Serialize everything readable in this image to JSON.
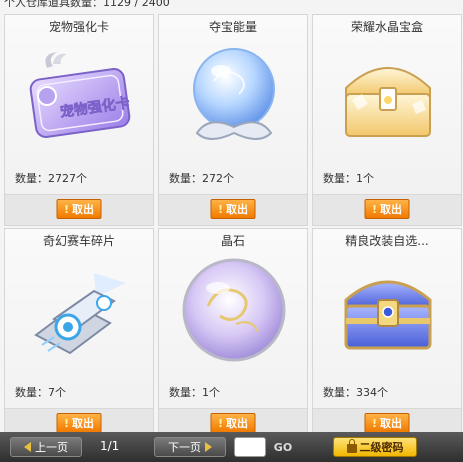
{
  "header": {
    "capacity_text": "个人仓库道具数量：1129 / 2400"
  },
  "items": [
    {
      "name": "宠物强化卡",
      "qty_label": "数量：",
      "qty": "2727个",
      "action": "取出",
      "icon": "pet-enhance-card-icon",
      "card_text": "宠物强化卡"
    },
    {
      "name": "夺宝能量",
      "qty_label": "数量：",
      "qty": "272个",
      "action": "取出",
      "icon": "energy-orb-icon"
    },
    {
      "name": "荣耀水晶宝盒",
      "qty_label": "数量：",
      "qty": "1个",
      "action": "取出",
      "icon": "crystal-chest-icon"
    },
    {
      "name": "奇幻赛车碎片",
      "qty_label": "数量：",
      "qty": "7个",
      "action": "取出",
      "icon": "kart-fragment-icon"
    },
    {
      "name": "晶石",
      "qty_label": "数量：",
      "qty": "1个",
      "action": "取出",
      "icon": "crystal-stone-icon"
    },
    {
      "name": "精良改装自选...",
      "qty_label": "数量：",
      "qty": "334个",
      "action": "取出",
      "icon": "mod-chest-icon"
    }
  ],
  "pagination": {
    "prev_label": "上一页",
    "next_label": "下一页",
    "page_indicator": "1/1",
    "go_label": "GO",
    "page_input_value": ""
  },
  "secondary_password_label": "二级密码",
  "colors": {
    "action_button": "#f07a00",
    "bottom_bar": "#3a3a3a",
    "password_button": "#f2b800"
  }
}
